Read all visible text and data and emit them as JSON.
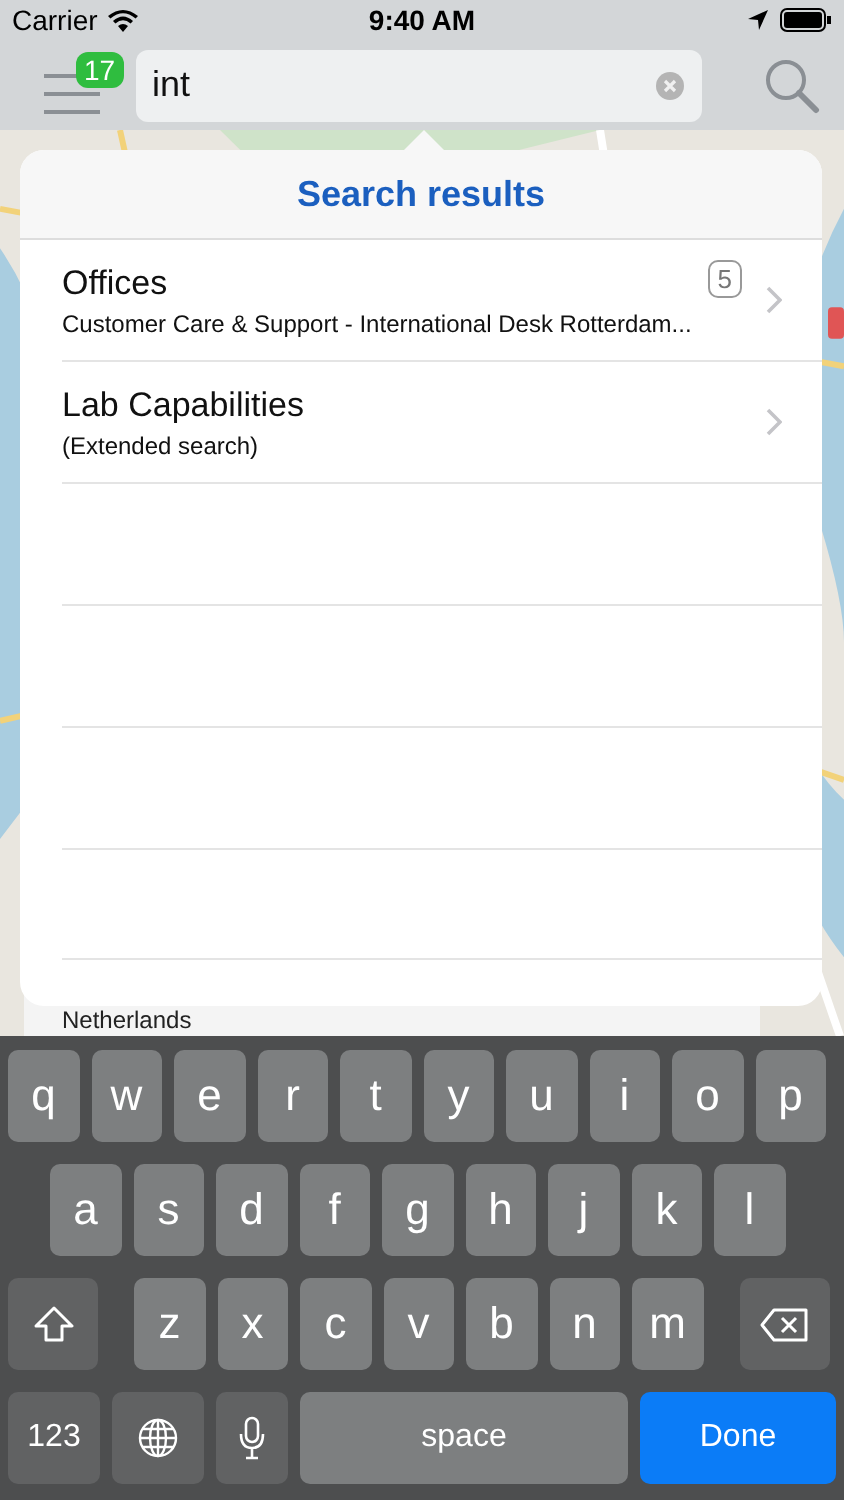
{
  "status_bar": {
    "carrier": "Carrier",
    "time": "9:40 AM"
  },
  "nav_bar": {
    "menu_badge": "17",
    "search": {
      "value": "int"
    }
  },
  "results": {
    "title": "Search results",
    "items": [
      {
        "title": "Offices",
        "subtitle": "Customer Care & Support - International Desk Rotterdam...",
        "count": "5"
      },
      {
        "title": "Lab Capabilities",
        "subtitle": "(Extended search)"
      }
    ]
  },
  "background_card": {
    "text": "Netherlands"
  },
  "keyboard": {
    "rows": [
      {
        "keys": [
          {
            "kind": "letter",
            "label": "q"
          },
          {
            "kind": "letter",
            "label": "w"
          },
          {
            "kind": "letter",
            "label": "e"
          },
          {
            "kind": "letter",
            "label": "r"
          },
          {
            "kind": "letter",
            "label": "t"
          },
          {
            "kind": "letter",
            "label": "y"
          },
          {
            "kind": "letter",
            "label": "u"
          },
          {
            "kind": "letter",
            "label": "i"
          },
          {
            "kind": "letter",
            "label": "o"
          },
          {
            "kind": "letter",
            "label": "p"
          }
        ]
      },
      {
        "keys": [
          {
            "kind": "letter",
            "label": "a"
          },
          {
            "kind": "letter",
            "label": "s"
          },
          {
            "kind": "letter",
            "label": "d"
          },
          {
            "kind": "letter",
            "label": "f"
          },
          {
            "kind": "letter",
            "label": "g"
          },
          {
            "kind": "letter",
            "label": "h"
          },
          {
            "kind": "letter",
            "label": "j"
          },
          {
            "kind": "letter",
            "label": "k"
          },
          {
            "kind": "letter",
            "label": "l"
          }
        ]
      },
      {
        "keys": [
          {
            "kind": "shift"
          },
          {
            "kind": "letter",
            "label": "z"
          },
          {
            "kind": "letter",
            "label": "x"
          },
          {
            "kind": "letter",
            "label": "c"
          },
          {
            "kind": "letter",
            "label": "v"
          },
          {
            "kind": "letter",
            "label": "b"
          },
          {
            "kind": "letter",
            "label": "n"
          },
          {
            "kind": "letter",
            "label": "m"
          },
          {
            "kind": "delete"
          }
        ]
      },
      {
        "keys": [
          {
            "kind": "numbers",
            "label": "123"
          },
          {
            "kind": "globe"
          },
          {
            "kind": "mic"
          },
          {
            "kind": "space",
            "label": "space"
          },
          {
            "kind": "done",
            "label": "Done"
          }
        ]
      }
    ]
  }
}
